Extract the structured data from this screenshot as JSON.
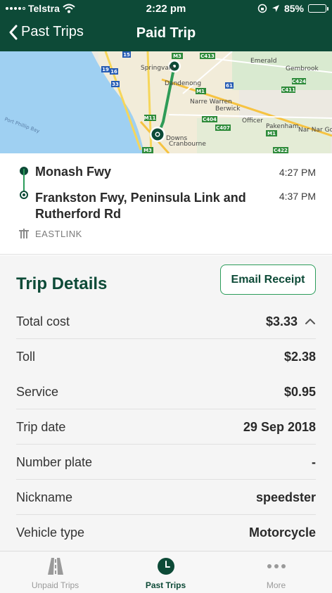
{
  "status_bar": {
    "carrier": "Telstra",
    "time": "2:22 pm",
    "battery": "85%",
    "battery_level": 0.85
  },
  "nav": {
    "back_label": "Past Trips",
    "title": "Paid Trip"
  },
  "map": {
    "labels": [
      "Springvale",
      "Dandenong",
      "Narre Warren",
      "Berwick",
      "Officer",
      "Pakenham",
      "Nar Nar Goon",
      "Emerald",
      "Gembrook",
      "Cranbourne",
      "Port Phillip Bay",
      "Downs"
    ],
    "road_shields": [
      "M3",
      "C413",
      "15",
      "19",
      "16",
      "33",
      "M1",
      "61",
      "C424",
      "C411",
      "M11",
      "C404",
      "C407",
      "M1",
      "C422",
      "M3"
    ]
  },
  "route": {
    "start_name": "Monash Fwy",
    "start_time": "4:27 PM",
    "end_name": "Frankston Fwy, Peninsula Link and Rutherford Rd",
    "end_time": "4:37 PM",
    "operator": "EASTLINK"
  },
  "details": {
    "heading": "Trip Details",
    "email_button": "Email Receipt",
    "rows": [
      {
        "label": "Total cost",
        "value": "$3.33"
      },
      {
        "label": "Toll",
        "value": "$2.38"
      },
      {
        "label": "Service",
        "value": "$0.95"
      },
      {
        "label": "Trip date",
        "value": "29 Sep 2018"
      },
      {
        "label": "Number plate",
        "value": "-"
      },
      {
        "label": "Nickname",
        "value": "speedster"
      },
      {
        "label": "Vehicle type",
        "value": "Motorcycle"
      }
    ]
  },
  "tabs": [
    {
      "label": "Unpaid Trips",
      "icon": "road-icon",
      "active": false
    },
    {
      "label": "Past Trips",
      "icon": "clock-icon",
      "active": true
    },
    {
      "label": "More",
      "icon": "more-dots-icon",
      "active": false
    }
  ],
  "colors": {
    "brand_dark": "#0d4a37",
    "brand_green": "#2b9c5a",
    "water": "#9fd0f2"
  }
}
